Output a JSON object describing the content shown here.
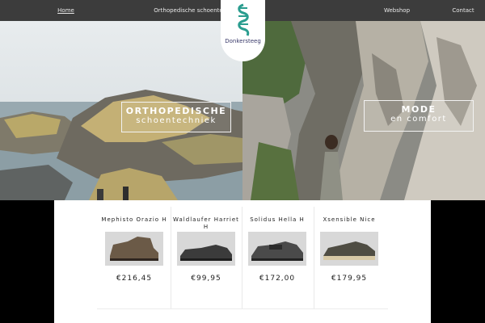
{
  "nav": {
    "home": "Home",
    "orthopedics": "Orthopedische schoentechniek",
    "webshop": "Webshop",
    "contact": "Contact"
  },
  "logo": {
    "text": "Donkersteeg",
    "icon": "foot-spiral-logo"
  },
  "hero": {
    "left": {
      "line1": "ORTHOPEDISCHE",
      "line2": "schoentechniek"
    },
    "right": {
      "line1": "MODE",
      "line2": "en comfort"
    }
  },
  "products": [
    {
      "name": "Mephisto Orazio H",
      "price": "€216,45"
    },
    {
      "name": "Waldlaufer Harriet H",
      "price": "€99,95"
    },
    {
      "name": "Solidus Hella H",
      "price": "€172,00"
    },
    {
      "name": "Xsensible Nice",
      "price": "€179,95"
    }
  ],
  "colors": {
    "nav_bg": "#464646",
    "logo_teal": "#2a9d8f",
    "text": "#222222"
  }
}
